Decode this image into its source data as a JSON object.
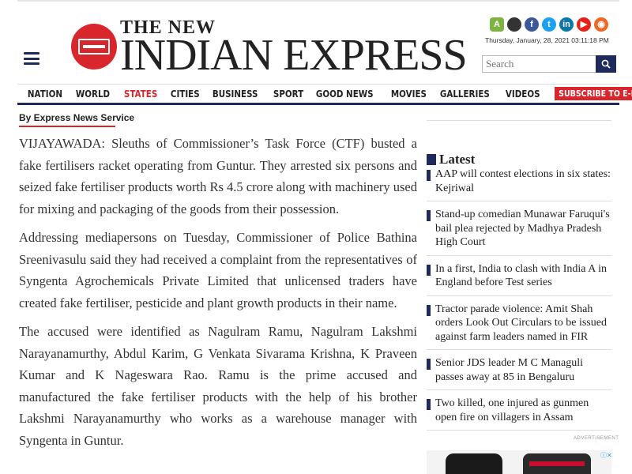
{
  "header": {
    "logo": {
      "line1": "THE NEW",
      "line2": "INDIAN EXPRESS"
    },
    "social_icons": [
      "android-icon",
      "apple-icon",
      "facebook-icon",
      "twitter-icon",
      "linkedin-icon",
      "youtube-icon",
      "rss-icon"
    ],
    "datetime": "Thursday, January, 28, 2021  03:11:18 PM",
    "search": {
      "placeholder": "Search",
      "value": ""
    }
  },
  "nav": {
    "items": [
      "NATION",
      "WORLD",
      "STATES",
      "CITIES",
      "BUSINESS",
      "SPORT",
      "GOOD NEWS",
      "MOVIES",
      "GALLERIES",
      "VIDEOS"
    ],
    "active": "STATES",
    "subscribe_label": "SUBSCRIBE TO E-PAPER"
  },
  "article": {
    "byline": "By Express News Service",
    "paragraphs": [
      "VIJAYAWADA: Sleuths of Commissioner’s Task Force (CTF) busted a fake fertilisers racket operating from Guntur. They arrested six persons and seized fake fertiliser products worth Rs 4.5 crore along with machinery used for mixing and packaging of the goods from their possession.",
      "Addressing mediapersons on Tuesday, Commissioner of Police Bathina Sreenivasulu said they had received a complaint from the representatives of Syngenta Agrochemicals Private Limited that unlicensed traders have created fake fertiliser, pesticide and plant growth products in their name.",
      "The accused were identified as Nagulram Ramu, Nagulram Lakshmi Narayanamurthy, Abdul Karim, G Venkata Sivarama Krishna, K Praveen Kumar and K Nageswara Rao. Ramu is the prime accused and manufactured the fake fertiliser products with the help of his brother Lakshmi Narayanamurthy who works as a warehouse manager with Syngenta in Guntur."
    ]
  },
  "sidebar": {
    "latest_title": "Latest",
    "items": [
      "AAP will contest elections in six states: Kejriwal",
      "Stand-up comedian Munawar Faruqui's bail plea rejected by Madhya Pradesh High Court",
      "In a first, India to clash with India A in England before Test series",
      "Tractor parade violence: Amit Shah orders Look Out Circulars to be issued against farm leaders named in FIR",
      "Senior JDS leader M C Managuli passes away at 85 in Bengaluru",
      "Two killed, one injured as gunmen open fire on villagers in Assam"
    ],
    "ad_label": "ADVERTISEMENT",
    "ad_close": "ⓘ✕"
  },
  "colors": {
    "brand_red": "#d8262c",
    "brand_navy": "#1f2a5c"
  }
}
